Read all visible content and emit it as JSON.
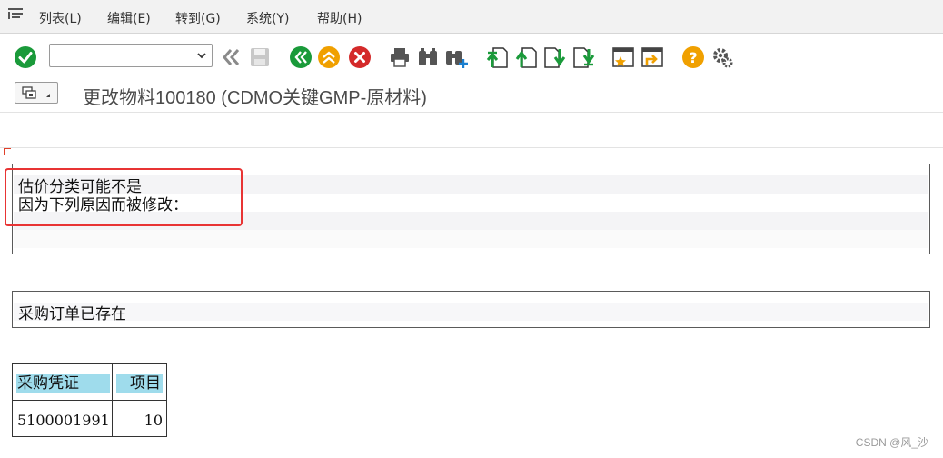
{
  "menu": {
    "items": [
      "列表(L)",
      "编辑(E)",
      "转到(G)",
      "系统(Y)",
      "帮助(H)"
    ]
  },
  "toolbar": {
    "command_field_value": "",
    "icons": [
      "check-icon",
      "back-double-icon",
      "save-icon",
      "back-icon",
      "exit-icon",
      "cancel-icon",
      "print-icon",
      "find-icon",
      "find-next-icon",
      "first-page-icon",
      "previous-page-icon",
      "next-page-icon",
      "last-page-icon",
      "create-session-icon",
      "shortcut-icon",
      "help-icon",
      "settings-icon"
    ]
  },
  "title": {
    "text": "更改物料100180 (CDMO关键GMP-原材料)"
  },
  "message_box1": {
    "line1": "估价分类可能不是",
    "line2": "因为下列原因而被修改："
  },
  "message_box2": {
    "line1": "采购订单已存在"
  },
  "table": {
    "headers": [
      "采购凭证",
      "项目"
    ],
    "rows": [
      [
        "5100001991",
        "10"
      ]
    ]
  },
  "watermark": "CSDN @风_沙",
  "colors": {
    "header_bg": "#9fdcec",
    "highlight_border": "#e83434",
    "check_green": "#1a9a3a",
    "cancel_red": "#d42a2a",
    "help_orange": "#f0a000"
  }
}
